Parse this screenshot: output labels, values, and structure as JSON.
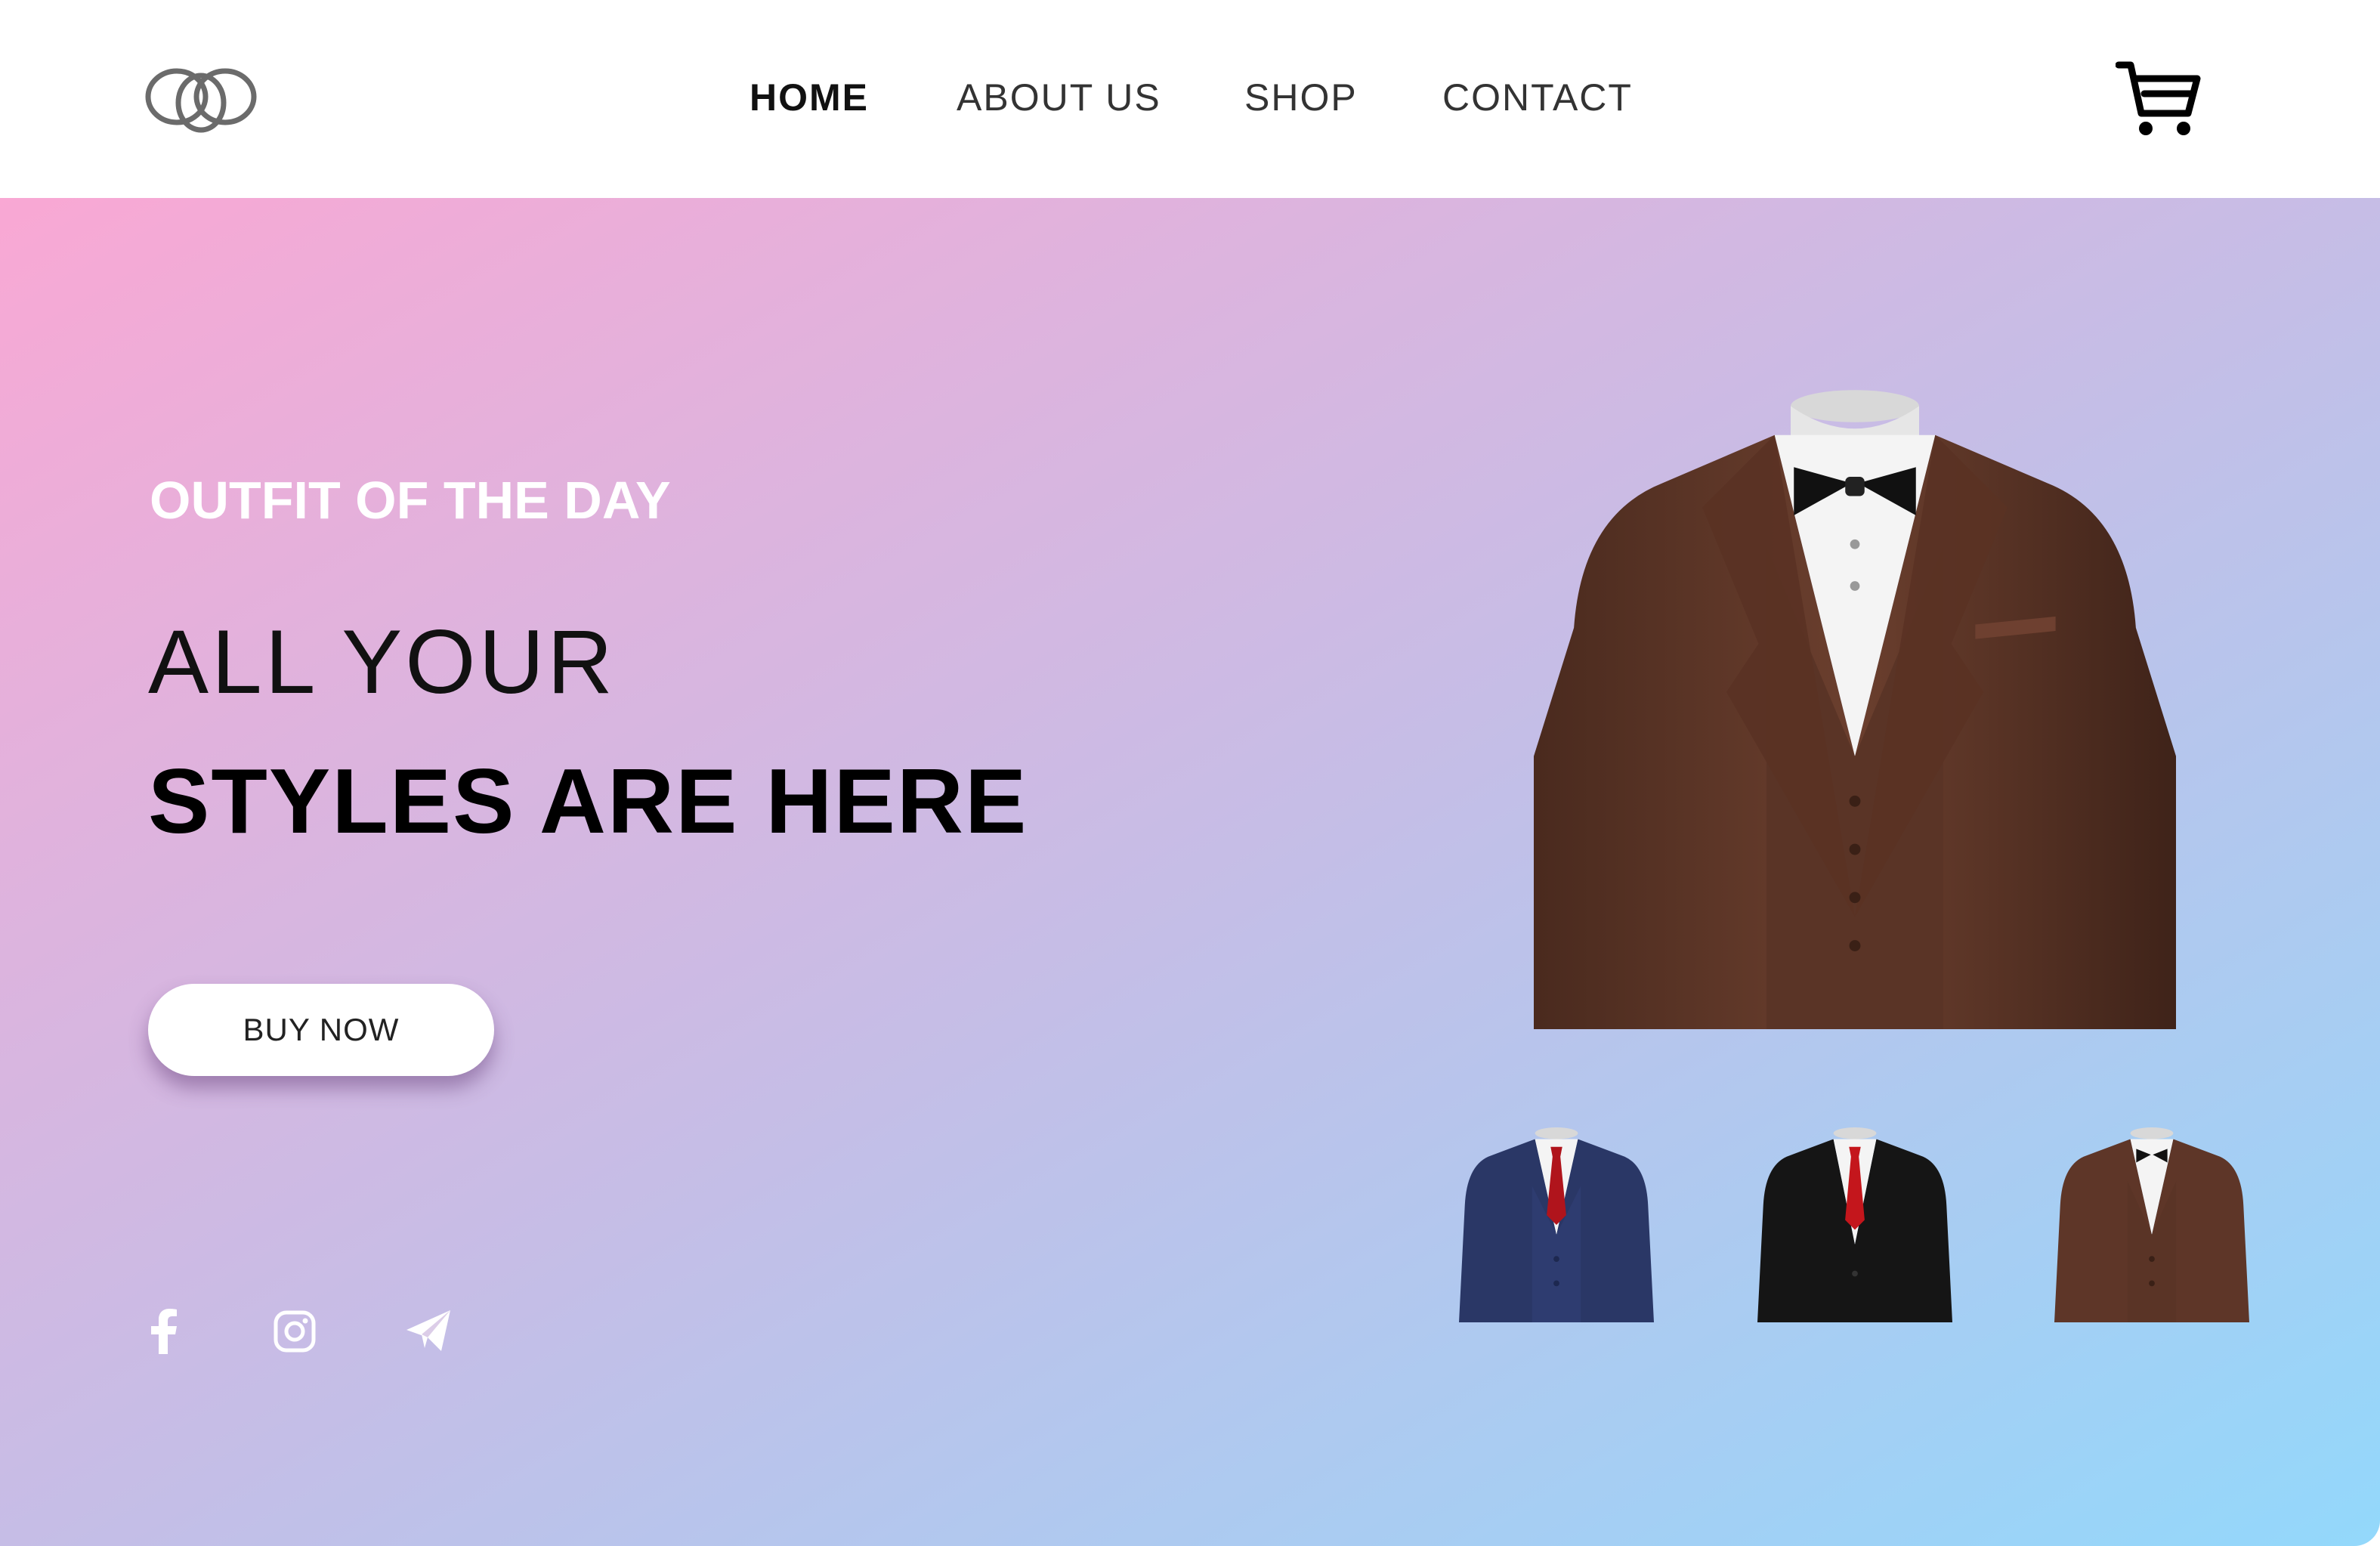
{
  "brand": {
    "logo_icon": "interlocking-circles-logo"
  },
  "nav": {
    "items": [
      {
        "label": "HOME",
        "active": true
      },
      {
        "label": "ABOUT US",
        "active": false
      },
      {
        "label": "SHOP",
        "active": false
      },
      {
        "label": "CONTACT",
        "active": false
      }
    ],
    "cart_icon": "shopping-cart-icon"
  },
  "hero": {
    "eyebrow": "OUTFIT OF THE DAY",
    "headline_line1": "ALL YOUR",
    "headline_line2": "STYLES ARE HERE",
    "cta_label": "BUY NOW",
    "gradient": {
      "from": "#f9a8d4",
      "to": "#93d8fb"
    }
  },
  "social": [
    {
      "icon": "facebook-icon"
    },
    {
      "icon": "instagram-icon"
    },
    {
      "icon": "telegram-icon"
    }
  ],
  "products": {
    "featured": {
      "jacket_color": "#5e3628",
      "vest_color": "#5a3426",
      "neckwear": "bow-tie",
      "neckwear_color": "#111111"
    },
    "thumbnails": [
      {
        "jacket_color": "#2a3766",
        "vest_color": "#2e3c70",
        "neckwear": "tie",
        "neckwear_color": "#b0141c"
      },
      {
        "jacket_color": "#151515",
        "vest_color": "#ffffff",
        "neckwear": "tie",
        "neckwear_color": "#c4161c"
      },
      {
        "jacket_color": "#5e3628",
        "vest_color": "#5a3426",
        "neckwear": "bow-tie",
        "neckwear_color": "#111111"
      }
    ]
  }
}
